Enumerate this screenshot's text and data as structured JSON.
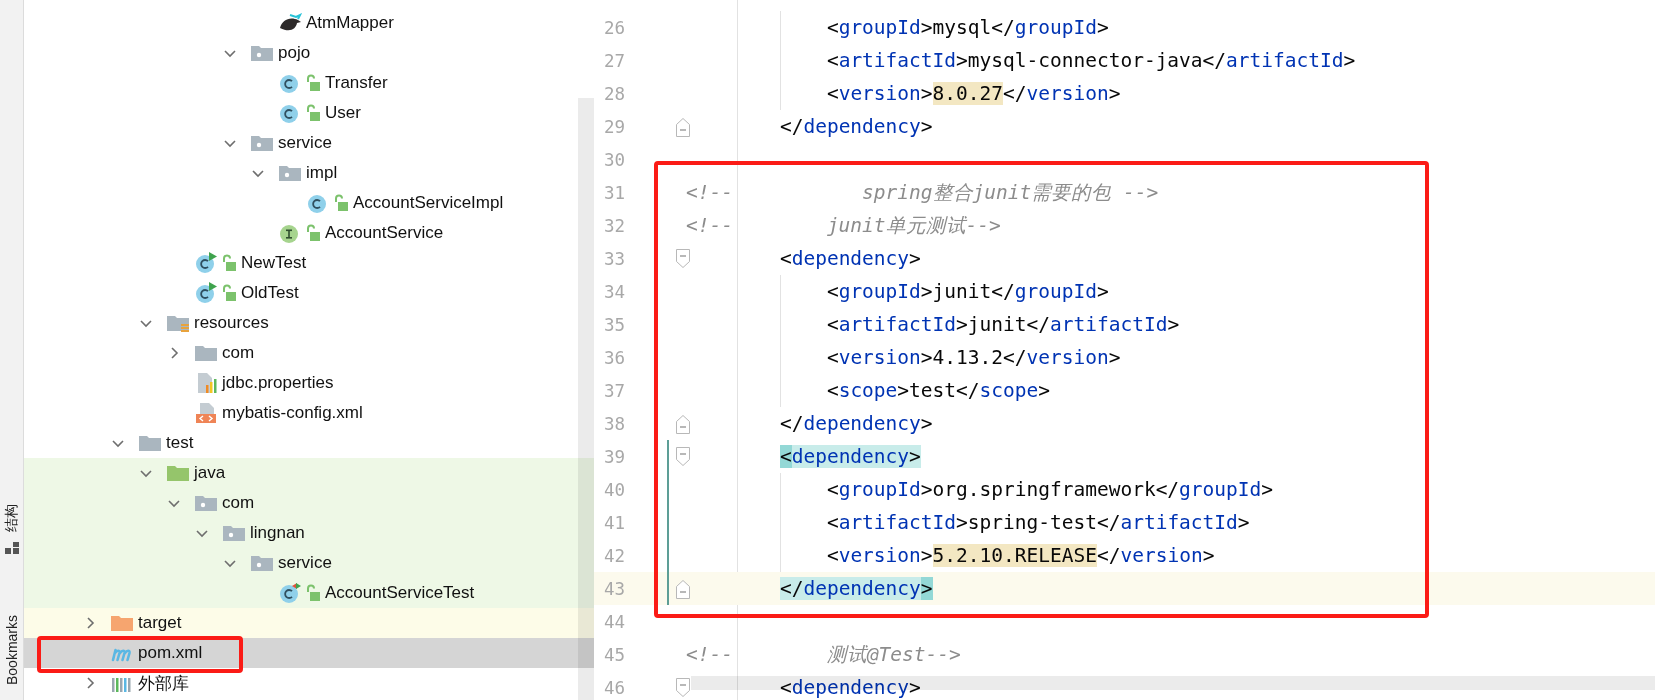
{
  "tool_strip": {
    "tabs": [
      {
        "label": "结构",
        "selected": false
      },
      {
        "label": "Bookmarks",
        "selected": false
      }
    ]
  },
  "tree": {
    "items": [
      {
        "children": [
          {
            "children": [
              {
                "children": [
                  {
                    "children": [
                      {
                        "children": [
                          {
                            "children": [
                              {
                                "label": "AtmMapper",
                                "kind": "mybatis-mapper",
                                "selected": false
                              }
                            ]
                          },
                          {
                            "label": "pojo",
                            "kind": "package",
                            "expanded": true,
                            "selected": false,
                            "children": [
                              {
                                "label": "Transfer",
                                "kind": "class",
                                "locked": true,
                                "selected": false
                              },
                              {
                                "label": "User",
                                "kind": "class",
                                "locked": true,
                                "selected": false
                              }
                            ]
                          },
                          {
                            "label": "service",
                            "kind": "package",
                            "expanded": true,
                            "selected": false,
                            "children": [
                              {
                                "label": "impl",
                                "kind": "package",
                                "expanded": true,
                                "selected": false,
                                "children": [
                                  {
                                    "label": "AccountServiceImpl",
                                    "kind": "class",
                                    "locked": true,
                                    "selected": false
                                  }
                                ]
                              },
                              {
                                "label": "AccountService",
                                "kind": "interface",
                                "locked": true,
                                "selected": false
                              }
                            ]
                          }
                        ]
                      }
                    ]
                  },
                  {
                    "label": "NewTest",
                    "kind": "runnable-class",
                    "locked": true,
                    "selected": false
                  },
                  {
                    "label": "OldTest",
                    "kind": "runnable-class",
                    "locked": true,
                    "selected": false
                  }
                ]
              },
              {
                "label": "resources",
                "kind": "resources-root",
                "expanded": true,
                "selected": false,
                "children": [
                  {
                    "label": "com",
                    "kind": "folder",
                    "expanded": false,
                    "selected": false
                  },
                  {
                    "label": "jdbc.properties",
                    "kind": "properties",
                    "selected": false
                  },
                  {
                    "label": "mybatis-config.xml",
                    "kind": "xml",
                    "selected": false
                  }
                ]
              }
            ]
          },
          {
            "label": "test",
            "kind": "folder",
            "expanded": true,
            "selected": false,
            "children": [
              {
                "label": "java",
                "kind": "source-root",
                "expanded": true,
                "test_source": true,
                "selected": false,
                "children": [
                  {
                    "label": "com",
                    "kind": "package",
                    "expanded": true,
                    "test_source": true,
                    "selected": false,
                    "children": [
                      {
                        "label": "lingnan",
                        "kind": "package",
                        "expanded": true,
                        "test_source": true,
                        "selected": false,
                        "children": [
                          {
                            "label": "service",
                            "kind": "package",
                            "expanded": true,
                            "test_source": true,
                            "selected": false,
                            "children": [
                              {
                                "label": "AccountServiceTest",
                                "kind": "test-class",
                                "locked": true,
                                "test_source": true,
                                "selected": false
                              }
                            ]
                          }
                        ]
                      }
                    ]
                  }
                ]
              }
            ]
          }
        ]
      },
      {
        "label": "target",
        "kind": "excluded-folder",
        "expanded": false,
        "excluded": true,
        "selected": false
      },
      {
        "label": "pom.xml",
        "kind": "maven",
        "selected": true,
        "boxed": true
      },
      {
        "label": "外部库",
        "kind": "library",
        "expanded": false,
        "selected": false
      }
    ]
  },
  "editor": {
    "lines": [
      {
        "number": "26",
        "tokens": [
          {
            "kind": "plain",
            "text": "            <"
          },
          {
            "kind": "tag",
            "text": "groupId"
          },
          {
            "kind": "plain",
            "text": ">mysql</"
          },
          {
            "kind": "tag",
            "text": "groupId"
          },
          {
            "kind": "plain",
            "text": ">"
          }
        ]
      },
      {
        "number": "27",
        "tokens": [
          {
            "kind": "plain",
            "text": "            <"
          },
          {
            "kind": "tag",
            "text": "artifactId"
          },
          {
            "kind": "plain",
            "text": ">mysql-connector-java</"
          },
          {
            "kind": "tag",
            "text": "artifactId"
          },
          {
            "kind": "plain",
            "text": ">"
          }
        ]
      },
      {
        "number": "28",
        "tokens": [
          {
            "kind": "plain",
            "text": "            <"
          },
          {
            "kind": "tag",
            "text": "version"
          },
          {
            "kind": "plain",
            "text": ">"
          },
          {
            "kind": "value",
            "text": "8.0.27"
          },
          {
            "kind": "plain",
            "text": "</"
          },
          {
            "kind": "tag",
            "text": "version"
          },
          {
            "kind": "plain",
            "text": ">"
          }
        ]
      },
      {
        "number": "29",
        "fold_end": true,
        "tokens": [
          {
            "kind": "plain",
            "text": "        </"
          },
          {
            "kind": "tag",
            "text": "dependency"
          },
          {
            "kind": "plain",
            "text": ">"
          }
        ]
      },
      {
        "number": "30"
      }
    ],
    "boxed_lines": [
      {
        "number": "31",
        "tokens": [
          {
            "kind": "comment",
            "text": "<!--           spring整合junit需要的包 -->"
          }
        ]
      },
      {
        "number": "32",
        "tokens": [
          {
            "kind": "comment",
            "text": "<!--        junit单元测试-->"
          }
        ]
      },
      {
        "number": "33",
        "fold_start": true,
        "tokens": [
          {
            "kind": "plain",
            "text": "        <"
          },
          {
            "kind": "tag",
            "text": "dependency"
          },
          {
            "kind": "plain",
            "text": ">"
          }
        ]
      },
      {
        "number": "34",
        "tokens": [
          {
            "kind": "plain",
            "text": "            <"
          },
          {
            "kind": "tag",
            "text": "groupId"
          },
          {
            "kind": "plain",
            "text": ">junit</"
          },
          {
            "kind": "tag",
            "text": "groupId"
          },
          {
            "kind": "plain",
            "text": ">"
          }
        ]
      },
      {
        "number": "35",
        "tokens": [
          {
            "kind": "plain",
            "text": "            <"
          },
          {
            "kind": "tag",
            "text": "artifactId"
          },
          {
            "kind": "plain",
            "text": ">junit</"
          },
          {
            "kind": "tag",
            "text": "artifactId"
          },
          {
            "kind": "plain",
            "text": ">"
          }
        ]
      },
      {
        "number": "36",
        "tokens": [
          {
            "kind": "plain",
            "text": "            <"
          },
          {
            "kind": "tag",
            "text": "version"
          },
          {
            "kind": "plain",
            "text": ">4.13.2</"
          },
          {
            "kind": "tag",
            "text": "version"
          },
          {
            "kind": "plain",
            "text": ">"
          }
        ]
      },
      {
        "number": "37",
        "tokens": [
          {
            "kind": "plain",
            "text": "            <"
          },
          {
            "kind": "tag",
            "text": "scope"
          },
          {
            "kind": "plain",
            "text": ">test</"
          },
          {
            "kind": "tag",
            "text": "scope"
          },
          {
            "kind": "plain",
            "text": ">"
          }
        ]
      },
      {
        "number": "38",
        "fold_end": true,
        "tokens": [
          {
            "kind": "plain",
            "text": "        </"
          },
          {
            "kind": "tag",
            "text": "dependency"
          },
          {
            "kind": "plain",
            "text": ">"
          }
        ]
      },
      {
        "number": "39",
        "fold_start": true,
        "changed": true,
        "tokens": [
          {
            "kind": "brace",
            "text": "        <"
          },
          {
            "kind": "match-tag",
            "text": "dependency"
          },
          {
            "kind": "match",
            "text": ">"
          }
        ]
      },
      {
        "number": "40",
        "changed": true,
        "tokens": [
          {
            "kind": "plain",
            "text": "            <"
          },
          {
            "kind": "tag",
            "text": "groupId"
          },
          {
            "kind": "plain",
            "text": ">org.springframework</"
          },
          {
            "kind": "tag",
            "text": "groupId"
          },
          {
            "kind": "plain",
            "text": ">"
          }
        ]
      },
      {
        "number": "41",
        "changed": true,
        "tokens": [
          {
            "kind": "plain",
            "text": "            <"
          },
          {
            "kind": "tag",
            "text": "artifactId"
          },
          {
            "kind": "plain",
            "text": ">spring-test</"
          },
          {
            "kind": "tag",
            "text": "artifactId"
          },
          {
            "kind": "plain",
            "text": ">"
          }
        ]
      },
      {
        "number": "42",
        "changed": true,
        "tokens": [
          {
            "kind": "plain",
            "text": "            <"
          },
          {
            "kind": "tag",
            "text": "version"
          },
          {
            "kind": "plain",
            "text": ">"
          },
          {
            "kind": "value",
            "text": "5.2.10.RELEASE"
          },
          {
            "kind": "plain",
            "text": "</"
          },
          {
            "kind": "tag",
            "text": "version"
          },
          {
            "kind": "plain",
            "text": ">"
          }
        ]
      },
      {
        "number": "43",
        "fold_end": true,
        "changed": true,
        "current": true,
        "tokens": [
          {
            "kind": "match",
            "text": "        </"
          },
          {
            "kind": "match-tag",
            "text": "dependency"
          },
          {
            "kind": "brace",
            "text": ">"
          }
        ]
      }
    ],
    "lines_after": [
      {
        "number": "44"
      },
      {
        "number": "45",
        "tokens": [
          {
            "kind": "comment",
            "text": "<!--        测试@Test-->"
          }
        ]
      },
      {
        "number": "46",
        "fold_start": true,
        "tokens": [
          {
            "kind": "plain",
            "text": "        <"
          },
          {
            "kind": "tag",
            "text": "dependency"
          },
          {
            "kind": "plain",
            "text": ">"
          }
        ]
      }
    ]
  }
}
